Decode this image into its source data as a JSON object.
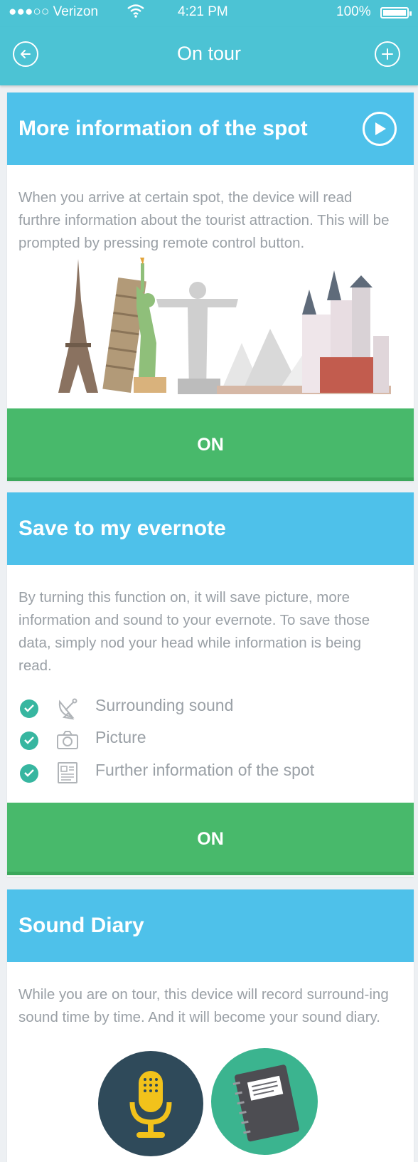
{
  "status_bar": {
    "carrier": "●●●○○ Verizon",
    "time": "4:21 PM",
    "battery": "100%"
  },
  "nav": {
    "title": "On tour",
    "back_icon": "back-arrow-circle-icon",
    "add_icon": "plus-circle-icon"
  },
  "cards": [
    {
      "title": "More information of the spot",
      "description": "When you arrive at certain spot, the device will read furthre information about the tourist attraction. This will be prompted by pressing remote control button.",
      "button_label": "ON",
      "illustration": "world-landmarks-illustration"
    },
    {
      "title": "Save to my evernote",
      "description": "By turning this function on, it will save picture, more information and sound to your evernote. To save those data, simply nod your head while information is being read.",
      "features": [
        {
          "label": "Surrounding sound",
          "icon": "satellite-dish-icon",
          "checked": true
        },
        {
          "label": "Picture",
          "icon": "camera-icon",
          "checked": true
        },
        {
          "label": "Further information of the spot",
          "icon": "document-icon",
          "checked": true
        }
      ],
      "button_label": "ON"
    },
    {
      "title": "Sound Diary",
      "description": "While you are on tour, this device will record surround-ing sound time by time. And it will become your sound diary.",
      "icons": [
        "microphone-icon",
        "notebook-icon"
      ]
    }
  ],
  "colors": {
    "nav_bg": "#4cc3d4",
    "card_header": "#4ec1ea",
    "on_button": "#48b96b",
    "check": "#37b6a0",
    "text_muted": "#9aa0a6"
  }
}
